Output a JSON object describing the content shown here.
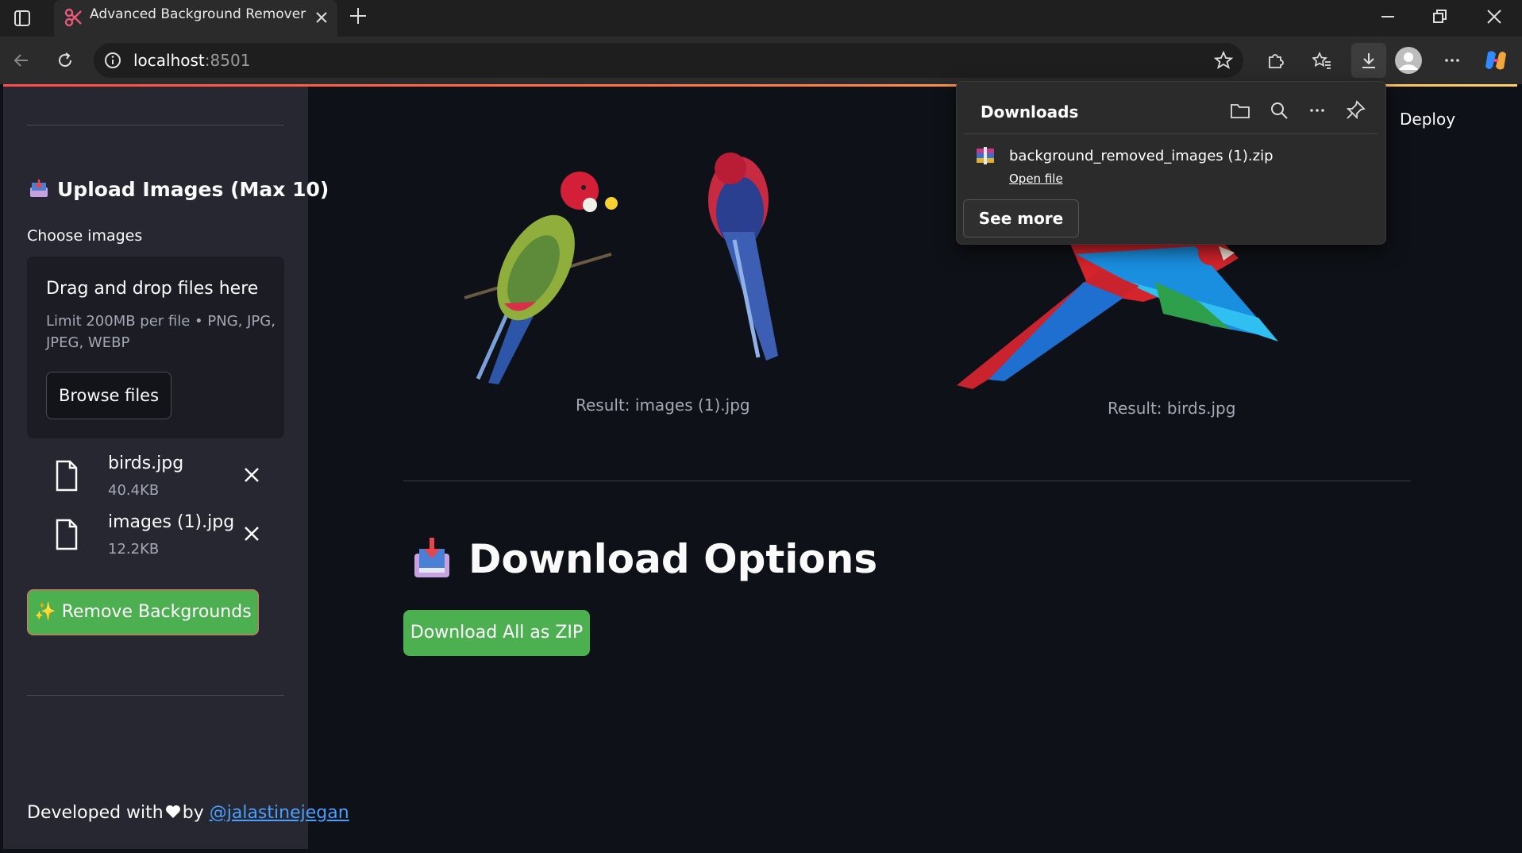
{
  "browser": {
    "tab_title": "Advanced Background Remover",
    "url_host": "localhost",
    "url_port": ":8501",
    "icons": [
      "tab-actions-icon",
      "scissors-favicon-icon",
      "close-icon",
      "plus-icon",
      "minimize-icon",
      "restore-icon",
      "close-window-icon",
      "back-icon",
      "refresh-icon",
      "info-icon",
      "favorite-star-icon",
      "extensions-icon",
      "favorites-icon",
      "download-icon",
      "profile-icon",
      "more-icon",
      "copilot-icon"
    ]
  },
  "downloads_panel": {
    "title": "Downloads",
    "file_name": "background_removed_images (1).zip",
    "open_file": "Open file",
    "see_more": "See more"
  },
  "sidebar": {
    "heading": "Upload Images (Max 10)",
    "choose_label": "Choose images",
    "dropzone": {
      "title": "Drag and drop files here",
      "subtitle": "Limit 200MB per file • PNG, JPG, JPEG, WEBP",
      "browse_label": "Browse files"
    },
    "files": [
      {
        "name": "birds.jpg",
        "size": "40.4KB"
      },
      {
        "name": "images (1).jpg",
        "size": "12.2KB"
      }
    ],
    "remove_button": "✨ Remove Backgrounds",
    "footer_prefix": "Developed with",
    "footer_by": "by",
    "footer_link": "@jalastinejegan"
  },
  "main": {
    "deploy": "Deploy",
    "results": [
      {
        "caption": "Result: images (1).jpg"
      },
      {
        "caption": "Result: birds.jpg"
      }
    ],
    "download_heading": "Download Options",
    "zip_button": "Download All as ZIP"
  },
  "colors": {
    "background": "#0e1117",
    "sidebar": "#262730",
    "accent_green": "#4caf50",
    "link": "#4a9fff"
  }
}
